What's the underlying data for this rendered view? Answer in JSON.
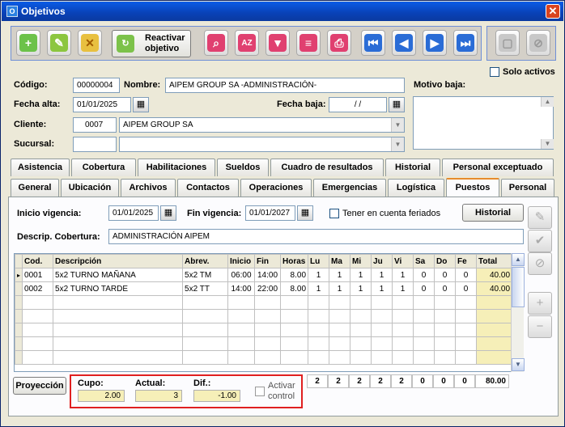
{
  "window": {
    "title": "Objetivos",
    "close_label": "✕"
  },
  "toolbar": {
    "reactivar_line1": "Reactivar",
    "reactivar_line2": "objetivo"
  },
  "solo_activos": {
    "label": "Solo activos",
    "checked": false
  },
  "form": {
    "codigo_label": "Código:",
    "codigo_value": "00000004",
    "nombre_label": "Nombre:",
    "nombre_value": "AIPEM GROUP SA -ADMINISTRACIÓN-",
    "motivo_baja_label": "Motivo baja:",
    "fecha_alta_label": "Fecha alta:",
    "fecha_alta_value": "01/01/2025",
    "fecha_baja_label": "Fecha baja:",
    "fecha_baja_value": "/ /",
    "cliente_label": "Cliente:",
    "cliente_code": "0007",
    "cliente_name": "AIPEM GROUP SA",
    "sucursal_label": "Sucursal:",
    "sucursal_code": "",
    "sucursal_name": ""
  },
  "tabs_row1": [
    "Asistencia",
    "Cobertura",
    "Habilitaciones",
    "Sueldos",
    "Cuadro de resultados",
    "Historial",
    "Personal exceptuado"
  ],
  "tabs_row2": [
    "General",
    "Ubicación",
    "Archivos",
    "Contactos",
    "Operaciones",
    "Emergencias",
    "Logística",
    "Puestos",
    "Personal"
  ],
  "active_tab": "Puestos",
  "puestos": {
    "inicio_label": "Inicio vigencia:",
    "inicio_value": "01/01/2025",
    "fin_label": "Fin vigencia:",
    "fin_value": "01/01/2027",
    "feriados_label": "Tener en cuenta feriados",
    "historial_btn": "Historial",
    "descrip_label": "Descrip. Cobertura:",
    "descrip_value": "ADMINISTRACIÓN AIPEM"
  },
  "grid": {
    "columns": [
      "Cod.",
      "Descripción",
      "Abrev.",
      "Inicio",
      "Fin",
      "Horas",
      "Lu",
      "Ma",
      "Mi",
      "Ju",
      "Vi",
      "Sa",
      "Do",
      "Fe",
      "Total"
    ],
    "rows": [
      [
        "0001",
        "5x2 TURNO MAÑANA",
        "5x2 TM",
        "06:00",
        "14:00",
        "8.00",
        "1",
        "1",
        "1",
        "1",
        "1",
        "0",
        "0",
        "0",
        "40.00"
      ],
      [
        "0002",
        "5x2 TURNO TARDE",
        "5x2 TT",
        "14:00",
        "22:00",
        "8.00",
        "1",
        "1",
        "1",
        "1",
        "1",
        "0",
        "0",
        "0",
        "40.00"
      ]
    ],
    "totals": [
      "2",
      "2",
      "2",
      "2",
      "2",
      "0",
      "0",
      "0",
      "80.00"
    ]
  },
  "proyeccion_btn": "Proyección",
  "control": {
    "cupo_label": "Cupo:",
    "cupo_value": "2.00",
    "actual_label": "Actual:",
    "actual_value": "3",
    "dif_label": "Dif.:",
    "dif_value": "-1.00",
    "activar_line1": "Activar",
    "activar_line2": "control",
    "highlight_color": "#e02020"
  }
}
